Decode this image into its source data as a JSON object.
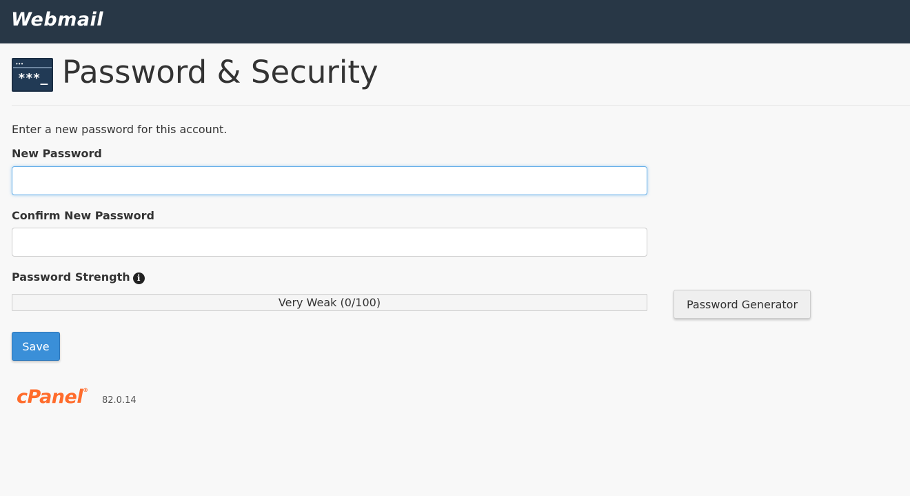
{
  "header": {
    "brand": "Webmail",
    "background_color": "#283746"
  },
  "page": {
    "icon": "password-security-icon",
    "icon_dots": "•••",
    "icon_stars": "***_",
    "title": "Password & Security"
  },
  "form": {
    "intro": "Enter a new password for this account.",
    "new_password_label": "New Password",
    "new_password_value": "",
    "confirm_password_label": "Confirm New Password",
    "confirm_password_value": "",
    "strength_label": "Password Strength",
    "strength_info_icon": "info-icon",
    "strength_text": "Very Weak (0/100)",
    "strength_value": 0,
    "generator_button": "Password Generator",
    "save_button": "Save",
    "accent_color": "#3a8fd8"
  },
  "footer": {
    "logo_text": "cPanel",
    "logo_mark": "®",
    "version": "82.0.14",
    "logo_color": "#ff6c2c"
  }
}
